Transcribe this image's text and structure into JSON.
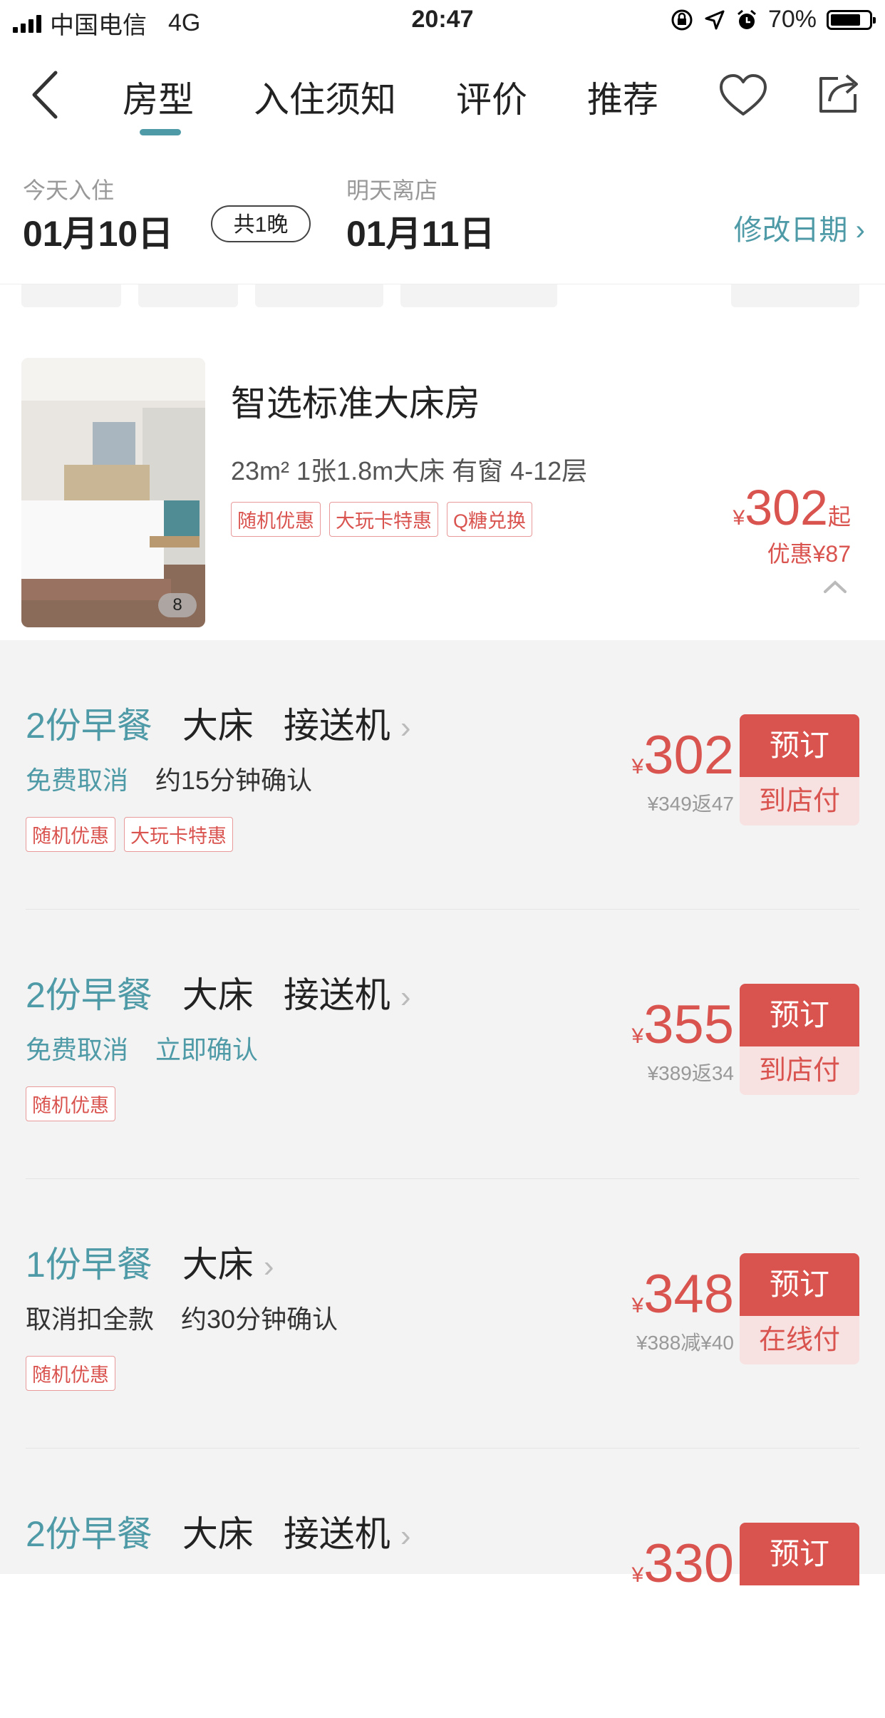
{
  "status_bar": {
    "carrier": "中国电信",
    "network": "4G",
    "time": "20:47",
    "battery": "70%"
  },
  "nav": {
    "tabs": [
      "房型",
      "入住须知",
      "评价",
      "推荐"
    ],
    "active_tab": "房型"
  },
  "dates": {
    "checkin_label": "今天入住",
    "checkin_date": "01月10日",
    "nights": "共1晚",
    "checkout_label": "明天离店",
    "checkout_date": "01月11日",
    "modify_label": "修改日期 ›"
  },
  "room": {
    "name": "智选标准大床房",
    "spec": "23m² 1张1.8m大床 有窗 4-12层",
    "photo_count": "8",
    "tags": [
      "随机优惠",
      "大玩卡特惠",
      "Q糖兑换"
    ],
    "price_symbol": "¥",
    "price": "302",
    "price_suffix": "起",
    "discount": "优惠¥87"
  },
  "offers": [
    {
      "meal": "2份早餐",
      "features": [
        "大床",
        "接送机"
      ],
      "cancel": "免费取消",
      "confirm": "约15分钟确认",
      "tags": [
        "随机优惠",
        "大玩卡特惠"
      ],
      "price": "302",
      "sub": "¥349返47",
      "book": "预订",
      "pay": "到店付"
    },
    {
      "meal": "2份早餐",
      "features": [
        "大床",
        "接送机"
      ],
      "cancel": "免费取消",
      "confirm": "立即确认",
      "tags": [
        "随机优惠"
      ],
      "price": "355",
      "sub": "¥389返34",
      "book": "预订",
      "pay": "到店付"
    },
    {
      "meal": "1份早餐",
      "features": [
        "大床"
      ],
      "cancel": "取消扣全款",
      "confirm": "约30分钟确认",
      "tags": [
        "随机优惠"
      ],
      "price": "348",
      "sub": "¥388减¥40",
      "book": "预订",
      "pay": "在线付"
    },
    {
      "meal": "2份早餐",
      "features": [
        "大床",
        "接送机"
      ],
      "cancel": "",
      "confirm": "",
      "tags": [],
      "price": "330",
      "sub": "",
      "book": "预订",
      "pay": ""
    }
  ],
  "colors": {
    "accent": "#4f9aa7",
    "price_red": "#d9534f"
  }
}
